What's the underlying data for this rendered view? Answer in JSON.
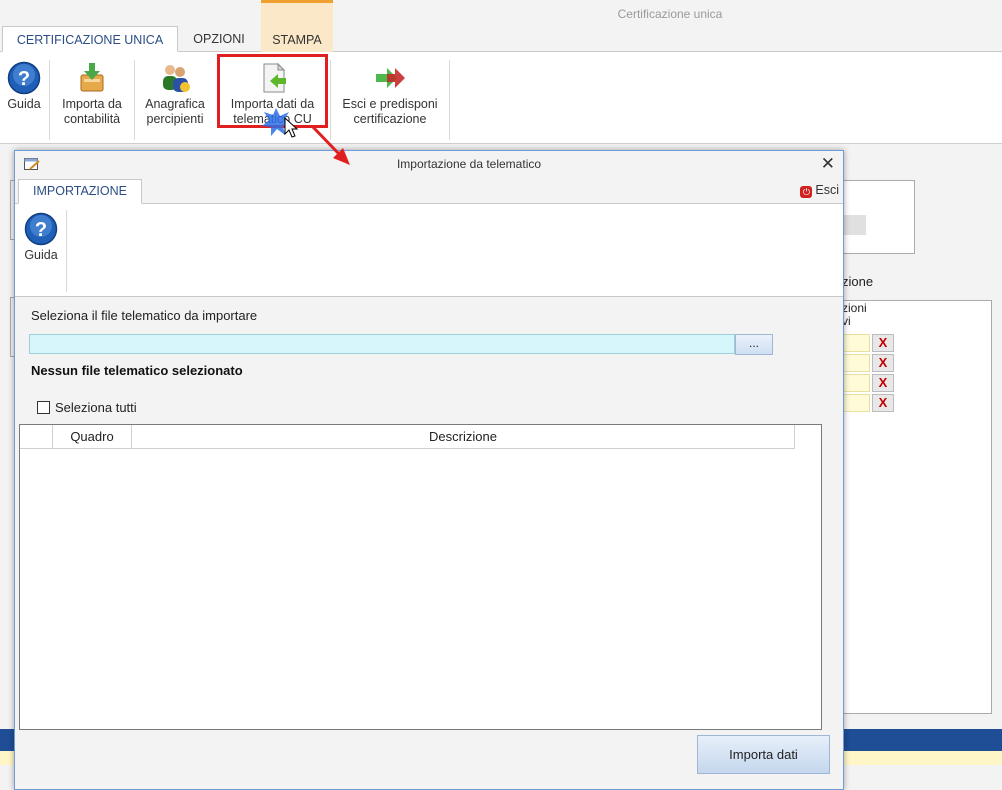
{
  "app": {
    "title": "Certificazione unica",
    "tabs": [
      {
        "label": "CERTIFICAZIONE UNICA"
      },
      {
        "label": "OPZIONI"
      },
      {
        "label": "STAMPA"
      }
    ],
    "ribbon": {
      "guida": "Guida",
      "importa_contabilita": [
        "Importa da",
        "contabilità"
      ],
      "anagrafica": [
        "Anagrafica",
        "percipienti"
      ],
      "importa_telematico": [
        "Importa dati da",
        "telematico CU"
      ],
      "esci_predisponi": [
        "Esci e predisponi",
        "certificazione"
      ]
    },
    "background": {
      "label_zione": "zione",
      "table_header": [
        "zioni",
        "vi"
      ],
      "delete_marks": [
        "X",
        "X",
        "X",
        "X"
      ]
    }
  },
  "dialog": {
    "title": "Importazione da telematico",
    "close": "✕",
    "tab": "IMPORTAZIONE",
    "exit": "Esci",
    "ribbon": {
      "guida": "Guida"
    },
    "select_label": "Seleziona il file telematico da importare",
    "file_input": {
      "value": "",
      "placeholder": ""
    },
    "browse_label": "...",
    "status_text": "Nessun file telematico selezionato",
    "select_all": {
      "label": "Seleziona tutti",
      "checked": false
    },
    "grid": {
      "columns": [
        "",
        "Quadro",
        "Descrizione"
      ],
      "rows": []
    },
    "import_button": "Importa dati"
  },
  "colors": {
    "accent_tab_text": "#2b4d86",
    "highlight_box": "#e02020",
    "input_bg": "#d6f6fb",
    "stampa_tab_bg": "#fbe8c8"
  },
  "icons": {
    "guida": "question-circle-icon",
    "importa_contabilita": "download-tray-icon",
    "anagrafica": "people-icon",
    "importa_telematico": "document-import-icon",
    "esci_predisponi": "arrow-right-icon",
    "dialog_window": "edit-window-icon",
    "esci": "power-icon"
  }
}
